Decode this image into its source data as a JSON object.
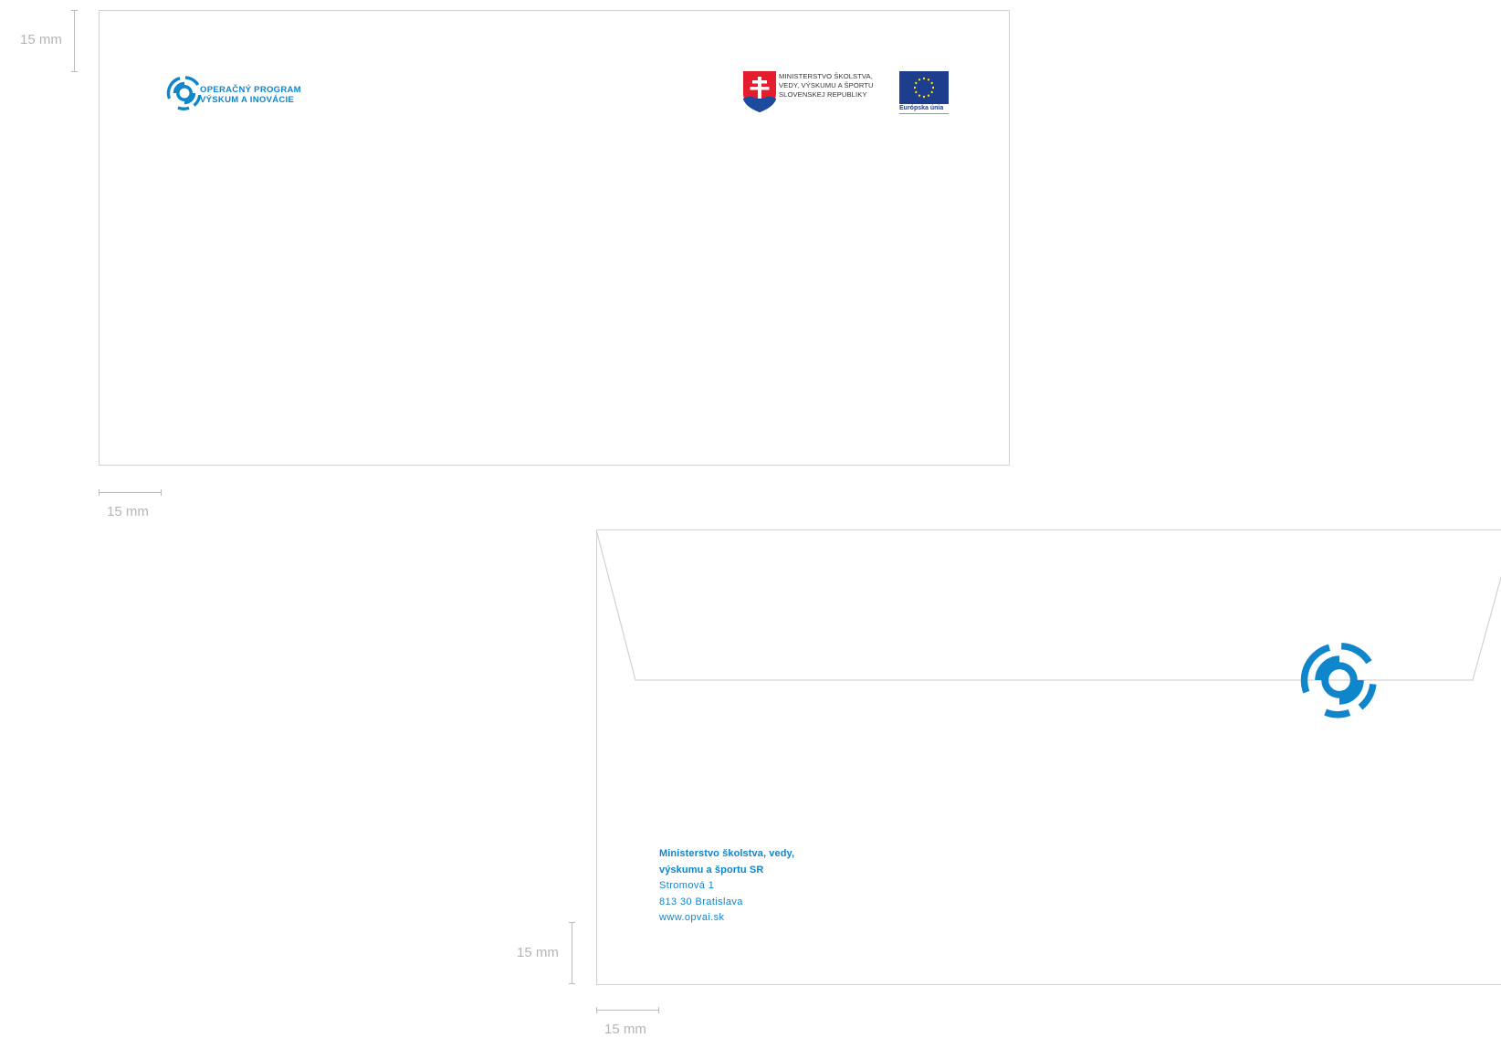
{
  "dimensions": {
    "front_top": "15 mm",
    "front_left": "15 mm",
    "back_bottom": "15 mm",
    "back_left": "15 mm"
  },
  "front": {
    "program_logo": {
      "line1": "OPERAČNÝ PROGRAM",
      "line2": "VÝSKUM A INOVÁCIE",
      "icon": "concentric-rings-logo-icon"
    },
    "ministry": {
      "line1": "MINISTERSTVO ŠKOLSTVA,",
      "line2": "VEDY, VÝSKUMU A ŠPORTU",
      "line3": "SLOVENSKEJ REPUBLIKY",
      "icon": "slovak-coat-of-arms-icon"
    },
    "eu": {
      "label": "Európska únia",
      "icon": "eu-flag-icon"
    }
  },
  "back": {
    "address": {
      "name1": "Ministerstvo školstva, vedy,",
      "name2": "výskumu a športu SR",
      "street": "Stromová 1",
      "city": "813 30 Bratislava",
      "web": "www.opvai.sk"
    },
    "logo_icon": "concentric-rings-logo-icon"
  },
  "colors": {
    "brand_blue": "#0f86cc",
    "eu_blue": "#1d3e8c",
    "eu_star": "#ffdd00",
    "slovak_red": "#e41d2c",
    "slovak_blue": "#1c4a9c",
    "border": "#d2d2d2",
    "dim": "#b5b5b5"
  }
}
